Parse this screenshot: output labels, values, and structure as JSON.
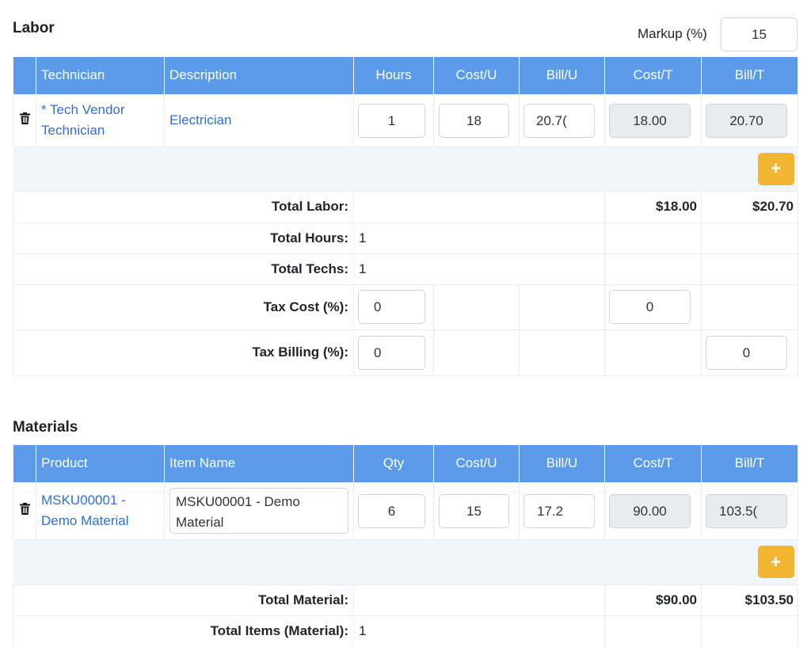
{
  "labor": {
    "title": "Labor",
    "markup_label": "Markup (%)",
    "markup_value": "15",
    "headers": [
      "Technician",
      "Description",
      "Hours",
      "Cost/U",
      "Bill/U",
      "Cost/T",
      "Bill/T"
    ],
    "row": {
      "technician_line1": "* Tech Vendor",
      "technician_line2": "Technician",
      "description": "Electrician",
      "hours": "1",
      "cost_u": "18",
      "bill_u": "20.7(",
      "cost_t": "18.00",
      "bill_t": "20.70"
    },
    "add_icon": "plus-icon",
    "add_symbol": "+",
    "total_labor_label": "Total Labor:",
    "total_labor_cost": "$18.00",
    "total_labor_bill": "$20.70",
    "total_hours_label": "Total Hours:",
    "total_hours_value": "1",
    "total_techs_label": "Total Techs:",
    "total_techs_value": "1",
    "tax_cost_label": "Tax Cost (%):",
    "tax_cost_value": "0",
    "tax_cost_total": "0",
    "tax_billing_label": "Tax Billing (%):",
    "tax_billing_value": "0",
    "tax_billing_total": "0"
  },
  "materials": {
    "title": "Materials",
    "headers": [
      "Product",
      "Item Name",
      "Qty",
      "Cost/U",
      "Bill/U",
      "Cost/T",
      "Bill/T"
    ],
    "row": {
      "product_line1": "MSKU00001 -",
      "product_line2": "Demo Material",
      "item_name_line1": "MSKU00001 - Demo",
      "item_name_line2": "Material",
      "qty": "6",
      "cost_u": "15",
      "bill_u": "17.2",
      "cost_t": "90.00",
      "bill_t": "103.5("
    },
    "add_symbol": "+",
    "total_material_label": "Total Material:",
    "total_material_cost": "$90.00",
    "total_material_bill": "$103.50",
    "total_items_label": "Total Items (Material):",
    "total_items_value": "1"
  },
  "colors": {
    "header_bg": "#5b9bea",
    "add_button": "#f3b632",
    "link": "#2f6fd6",
    "add_row_bg": "#f1f6fd"
  }
}
